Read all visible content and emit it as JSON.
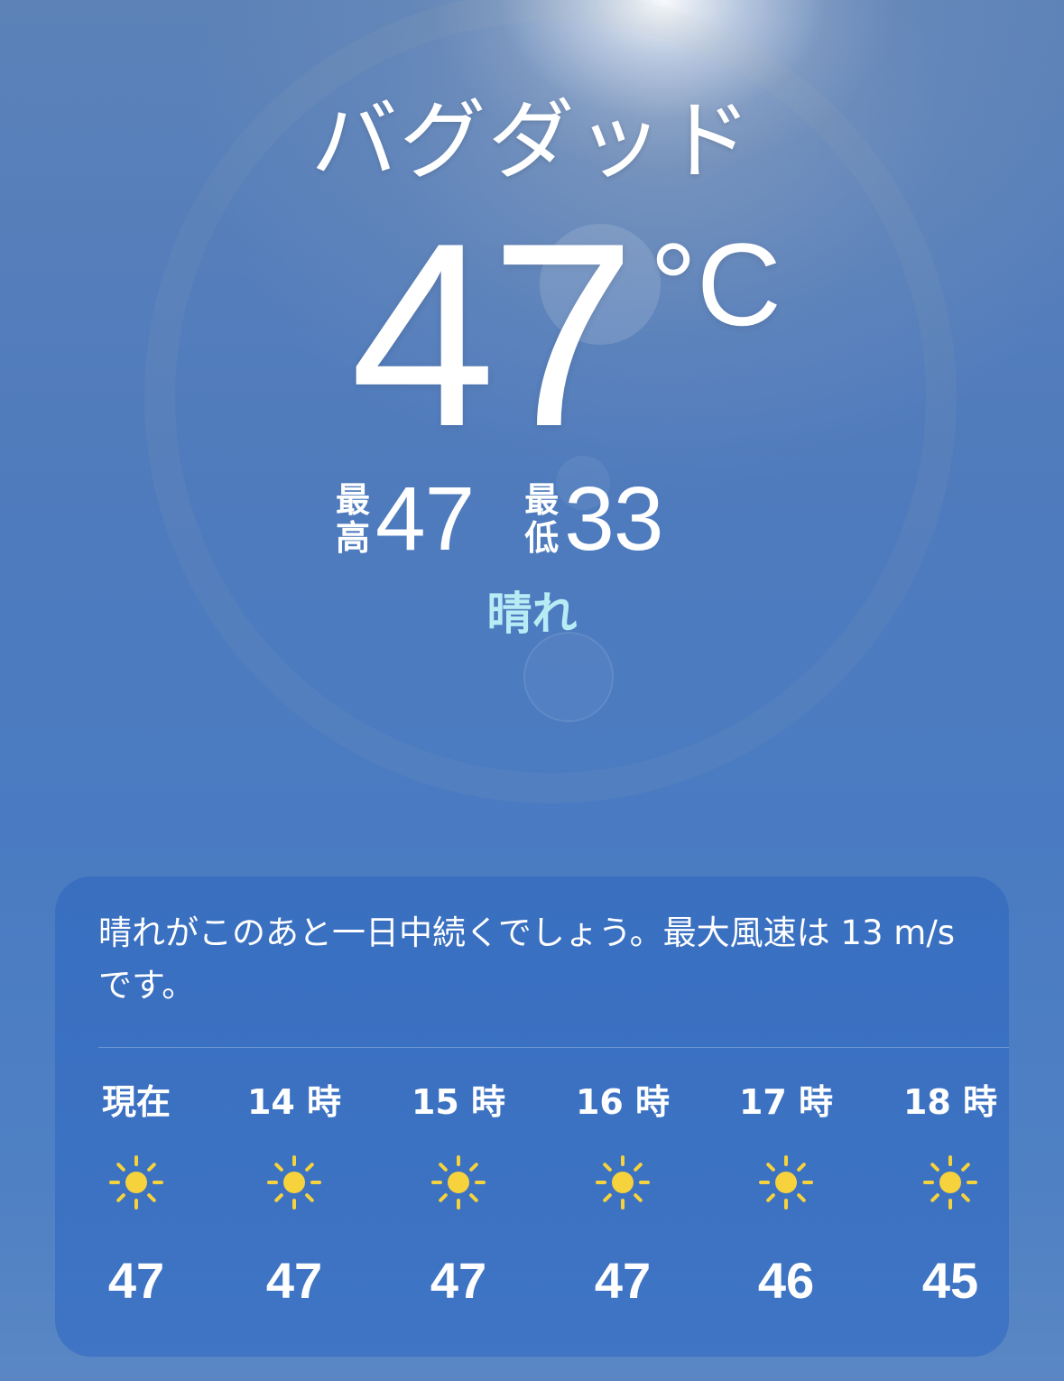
{
  "location": {
    "city": "バグダッド",
    "current_temp": "47",
    "temp_unit": "°C",
    "high_label": "最高",
    "high_value": "47",
    "low_label": "最低",
    "low_value": "33",
    "condition": "晴れ"
  },
  "forecast_card": {
    "summary": "晴れがこのあと一日中続くでしょう。最大風速は 13 m/s です。",
    "hours": [
      {
        "label": "現在",
        "icon": "sun-icon",
        "temp": "47"
      },
      {
        "label": "14 時",
        "icon": "sun-icon",
        "temp": "47"
      },
      {
        "label": "15 時",
        "icon": "sun-icon",
        "temp": "47"
      },
      {
        "label": "16 時",
        "icon": "sun-icon",
        "temp": "47"
      },
      {
        "label": "17 時",
        "icon": "sun-icon",
        "temp": "46"
      },
      {
        "label": "18 時",
        "icon": "sun-icon",
        "temp": "45"
      }
    ]
  },
  "colors": {
    "condition_text": "#b8ecf5",
    "sun": "#f6d23c",
    "card_background": "#3c72c4"
  }
}
